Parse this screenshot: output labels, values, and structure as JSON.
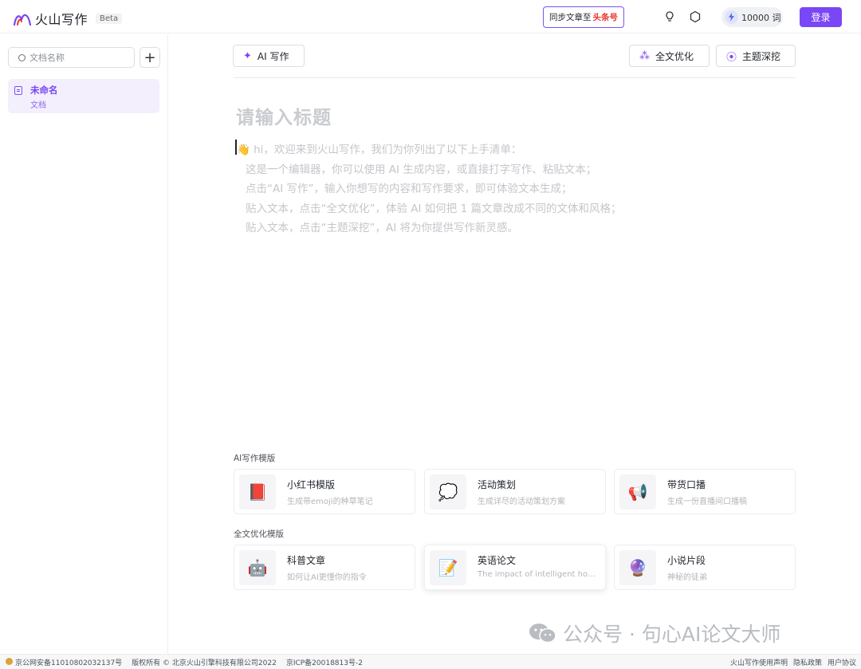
{
  "header": {
    "logo_text": "火山写作",
    "beta": "Beta",
    "sync_label": "同步文章至",
    "sync_brand": "头条号",
    "word_count": "10000 词",
    "login": "登录"
  },
  "sidebar": {
    "search_placeholder": "文档名称",
    "add_label": "+",
    "docs": [
      {
        "title": "未命名",
        "subtitle": "文档"
      }
    ]
  },
  "toolbar": {
    "ai_write": "AI 写作",
    "full_optimize": "全文优化",
    "topic_explore": "主题深挖"
  },
  "editor": {
    "title_placeholder": "请输入标题",
    "intro_lines": [
      "hi，欢迎来到火山写作，我们为你列出了以下上手清单：",
      "这是一个编辑器，你可以使用 AI 生成内容，或直接打字写作、粘贴文本；",
      "点击“AI 写作”，输入你想写的内容和写作要求，即可体验文本生成；",
      "贴入文本，点击“全文优化”，体验 AI 如何把 1 篇文章改成不同的文体和风格；",
      "贴入文本，点击“主题深挖”，AI 将为你提供写作新灵感。"
    ]
  },
  "templates": {
    "ai_section": "AI写作模版",
    "ai_cards": [
      {
        "title": "小红书模版",
        "desc": "生成带emoji的种草笔记",
        "icon": "book-icon"
      },
      {
        "title": "活动策划",
        "desc": "生成详尽的活动策划方案",
        "icon": "speech-bubble-icon"
      },
      {
        "title": "带货口播",
        "desc": "生成一份直播间口播稿",
        "icon": "megaphone-icon"
      }
    ],
    "opt_section": "全文优化模版",
    "opt_cards": [
      {
        "title": "科普文章",
        "desc": "如何让AI更懂你的指令",
        "icon": "robot-icon"
      },
      {
        "title": "英语论文",
        "desc": "The impact of intelligent hou…",
        "icon": "memo-icon"
      },
      {
        "title": "小说片段",
        "desc": "神秘的徒弟",
        "icon": "crystal-ball-icon"
      }
    ]
  },
  "watermark": {
    "text": "公众号 · 句心AI论文大师"
  },
  "footer": {
    "police": "京公网安备11010802032137号",
    "copyright": "版权所有 © 北京火山引擎科技有限公司2022",
    "icp": "京ICP备20018813号-2",
    "links": [
      "火山写作使用声明",
      "隐私政策",
      "用户协议"
    ]
  },
  "colors": {
    "accent": "#7a47f6",
    "brand_red": "#e8362e"
  }
}
